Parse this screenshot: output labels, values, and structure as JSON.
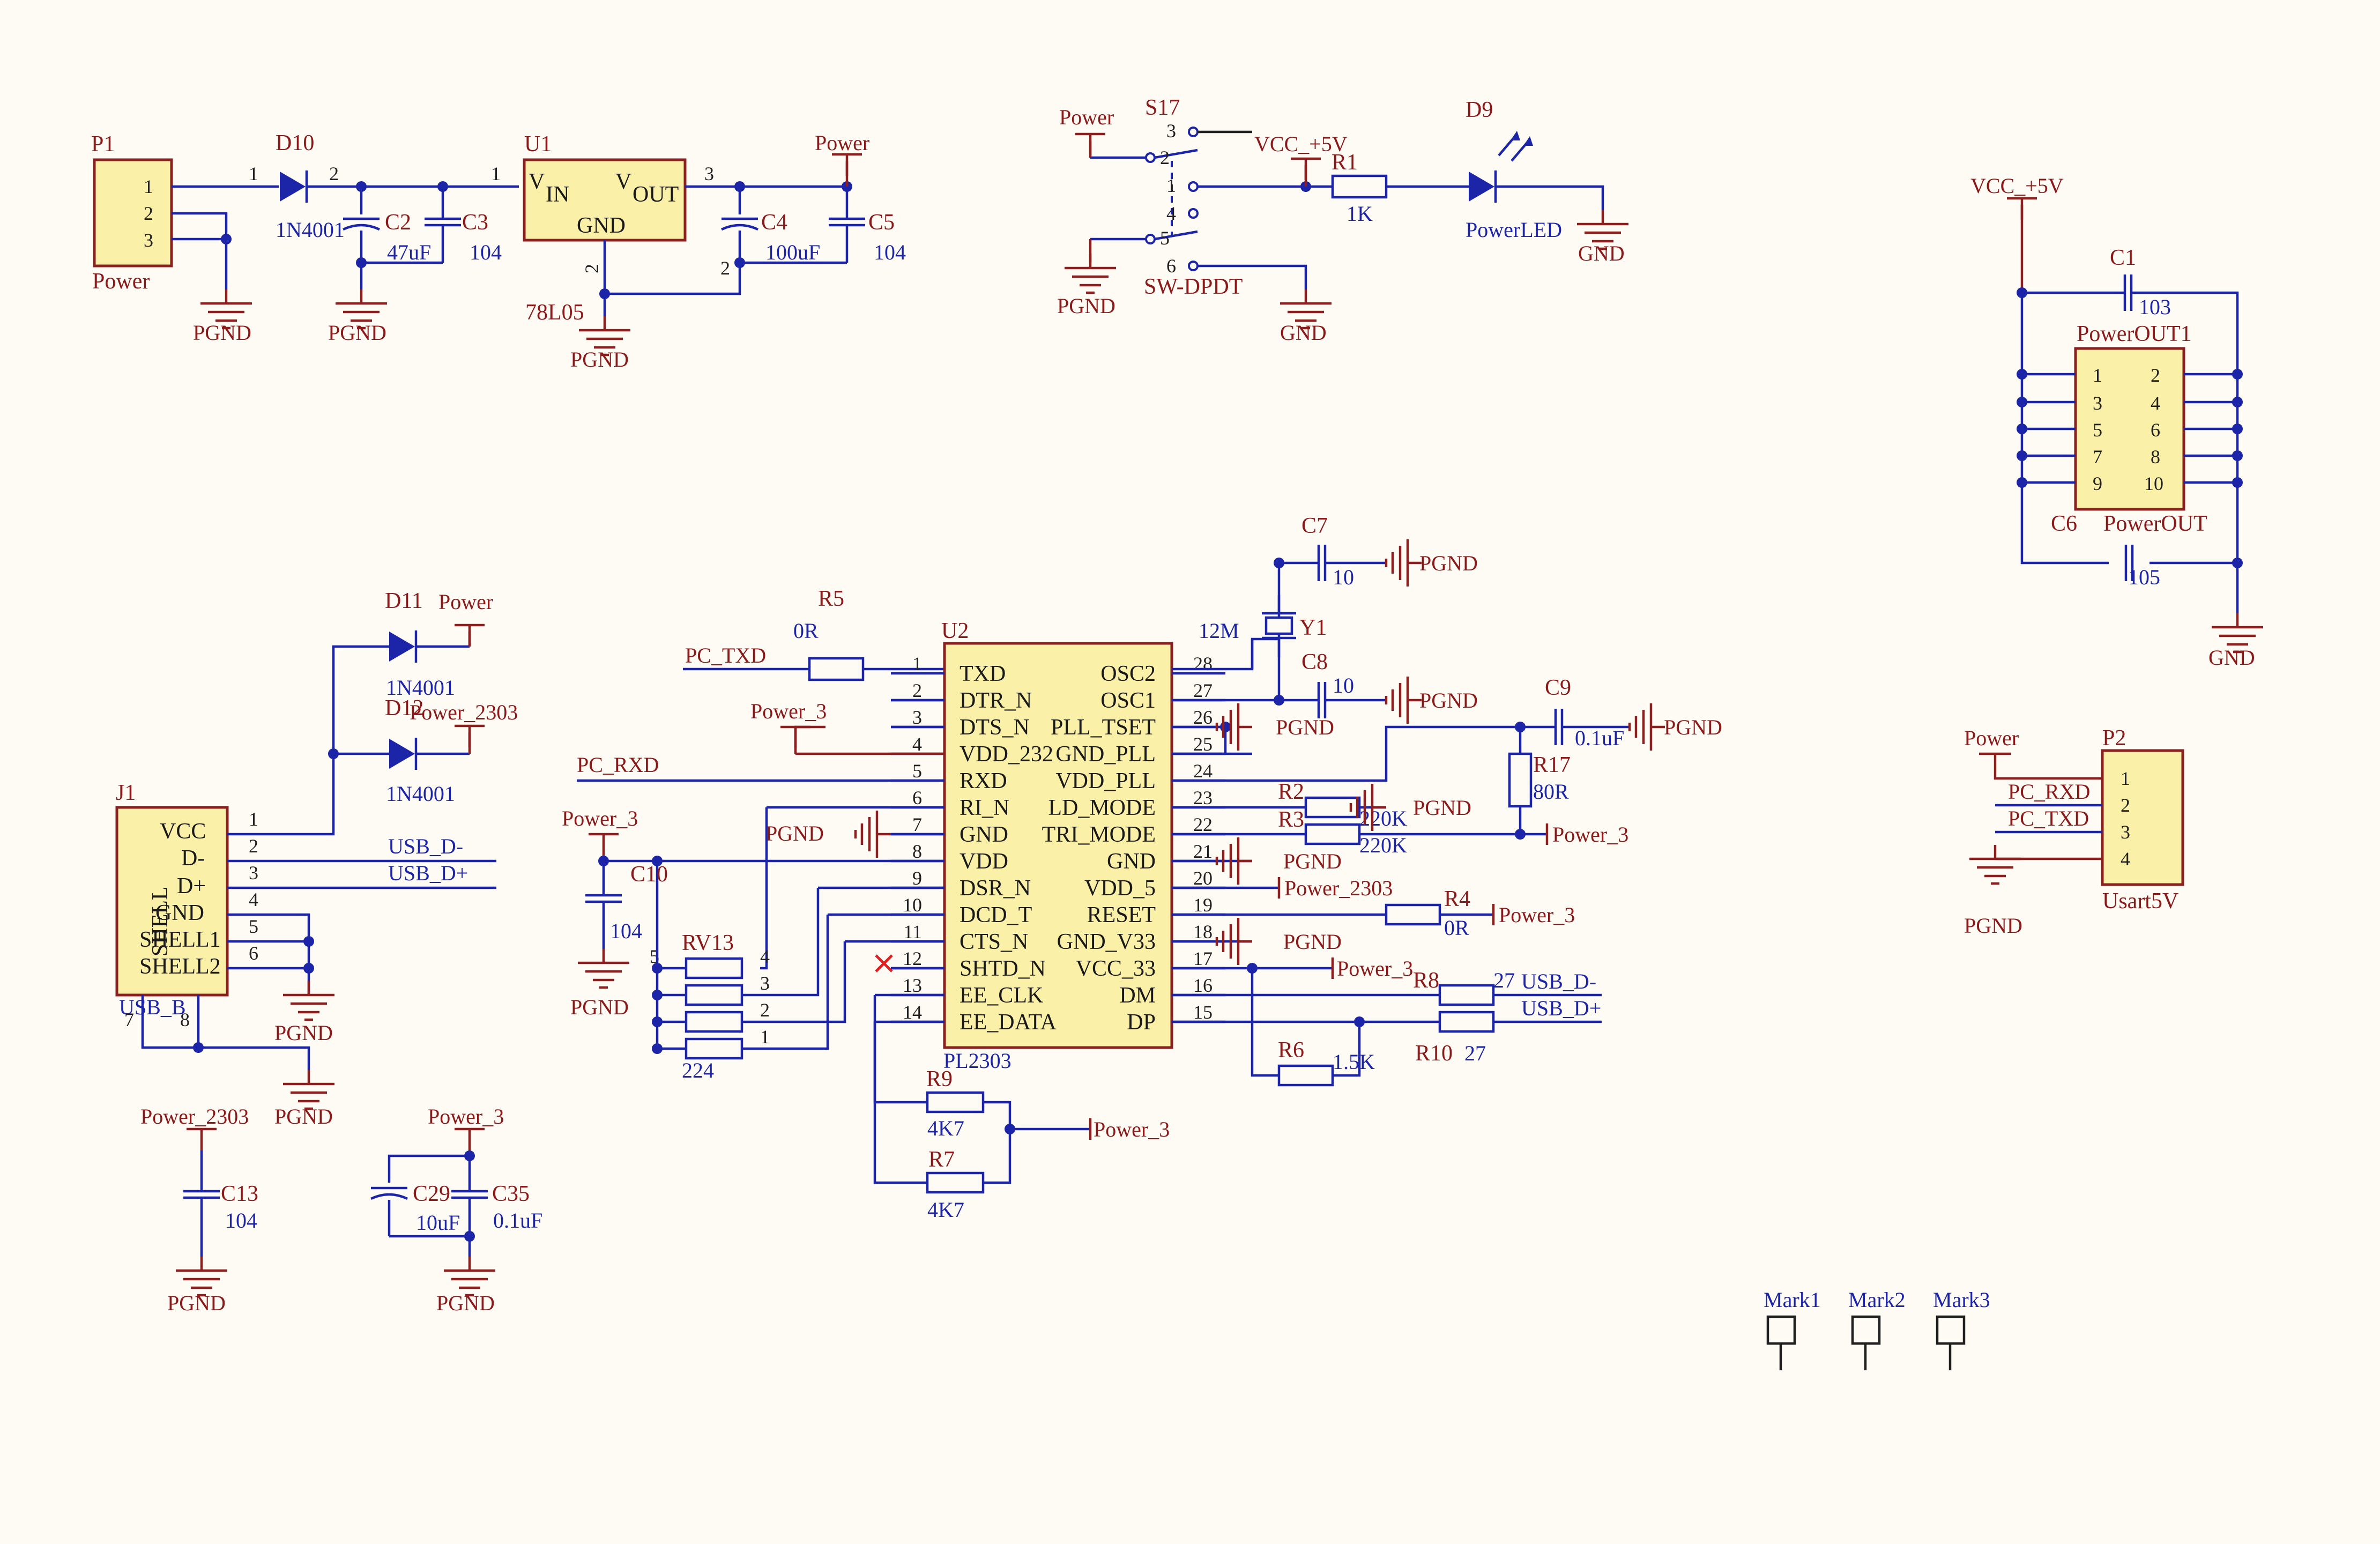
{
  "components": {
    "p1": {
      "ref": "P1",
      "value": "Power",
      "pins": [
        "1",
        "2",
        "3"
      ]
    },
    "d10": {
      "ref": "D10",
      "value": "1N4001",
      "pin_a": "1",
      "pin_k": "2"
    },
    "c2": {
      "ref": "C2",
      "value": "47uF"
    },
    "c3": {
      "ref": "C3",
      "value": "104"
    },
    "u1": {
      "ref": "U1",
      "value": "78L05",
      "vin": "V",
      "vin_sub": "IN",
      "vout": "V",
      "vout_sub": "OUT",
      "gnd": "GND",
      "pin1": "1",
      "pin2": "2",
      "pin3": "3"
    },
    "c4": {
      "ref": "C4",
      "value": "100uF"
    },
    "c5": {
      "ref": "C5",
      "value": "104"
    },
    "s17": {
      "ref": "S17",
      "value": "SW-DPDT",
      "pins": [
        "1",
        "2",
        "3",
        "4",
        "5",
        "6"
      ]
    },
    "r1": {
      "ref": "R1",
      "value": "1K"
    },
    "d9": {
      "ref": "D9",
      "value": "PowerLED"
    },
    "c1": {
      "ref": "C1",
      "value": "103"
    },
    "powerout1": {
      "ref": "PowerOUT1",
      "value": "PowerOUT",
      "left_pins": [
        "1",
        "3",
        "5",
        "7",
        "9"
      ],
      "right_pins": [
        "2",
        "4",
        "6",
        "8",
        "10"
      ]
    },
    "c6": {
      "ref": "C6",
      "value": "105"
    },
    "d11": {
      "ref": "D11",
      "value": "1N4001"
    },
    "d12": {
      "ref": "D12",
      "value": "1N4001"
    },
    "j1": {
      "ref": "J1",
      "value": "USB_B",
      "pins": [
        "1",
        "2",
        "3",
        "4",
        "5",
        "6"
      ],
      "signals": [
        "VCC",
        "D-",
        "D+",
        "GND",
        "SHELL1",
        "SHELL2"
      ],
      "shell": "SHELL",
      "extra_pins": [
        "7",
        "8"
      ]
    },
    "r5": {
      "ref": "R5",
      "value": "0R"
    },
    "u2": {
      "ref": "U2",
      "value": "PL2303",
      "left": [
        {
          "n": "1",
          "s": "TXD"
        },
        {
          "n": "2",
          "s": "DTR_N"
        },
        {
          "n": "3",
          "s": "DTS_N"
        },
        {
          "n": "4",
          "s": "VDD_232"
        },
        {
          "n": "5",
          "s": "RXD"
        },
        {
          "n": "6",
          "s": "RI_N"
        },
        {
          "n": "7",
          "s": "GND"
        },
        {
          "n": "8",
          "s": "VDD"
        },
        {
          "n": "9",
          "s": "DSR_N"
        },
        {
          "n": "10",
          "s": "DCD_T"
        },
        {
          "n": "11",
          "s": "CTS_N"
        },
        {
          "n": "12",
          "s": "SHTD_N"
        },
        {
          "n": "13",
          "s": "EE_CLK"
        },
        {
          "n": "14",
          "s": "EE_DATA"
        }
      ],
      "right": [
        {
          "n": "28",
          "s": "OSC2"
        },
        {
          "n": "27",
          "s": "OSC1"
        },
        {
          "n": "26",
          "s": "PLL_TSET"
        },
        {
          "n": "25",
          "s": "GND_PLL"
        },
        {
          "n": "24",
          "s": "VDD_PLL"
        },
        {
          "n": "23",
          "s": "LD_MODE"
        },
        {
          "n": "22",
          "s": "TRI_MODE"
        },
        {
          "n": "21",
          "s": "GND"
        },
        {
          "n": "20",
          "s": "VDD_5"
        },
        {
          "n": "19",
          "s": "RESET"
        },
        {
          "n": "18",
          "s": "GND_V33"
        },
        {
          "n": "17",
          "s": "VCC_33"
        },
        {
          "n": "16",
          "s": "DM"
        },
        {
          "n": "15",
          "s": "DP"
        }
      ]
    },
    "c10": {
      "ref": "C10",
      "value": "104"
    },
    "rv13": {
      "ref": "RV13",
      "value": "224",
      "pins": [
        "5",
        "4",
        "3",
        "2",
        "1"
      ]
    },
    "c7": {
      "ref": "C7",
      "value": "10"
    },
    "c8": {
      "ref": "C8",
      "value": "10"
    },
    "y1": {
      "ref": "Y1",
      "value": "12M"
    },
    "c9": {
      "ref": "C9",
      "value": "0.1uF"
    },
    "r17": {
      "ref": "R17",
      "value": "80R"
    },
    "r2": {
      "ref": "R2",
      "value": "220K"
    },
    "r3": {
      "ref": "R3",
      "value": "220K"
    },
    "r4": {
      "ref": "R4",
      "value": "0R"
    },
    "r8": {
      "ref": "R8",
      "value": "27"
    },
    "r10": {
      "ref": "R10",
      "value": "27"
    },
    "r6": {
      "ref": "R6",
      "value": "1.5K"
    },
    "r9": {
      "ref": "R9",
      "value": "4K7"
    },
    "r7": {
      "ref": "R7",
      "value": "4K7"
    },
    "p2": {
      "ref": "P2",
      "value": "Usart5V",
      "pins": [
        "1",
        "2",
        "3",
        "4"
      ]
    },
    "c13": {
      "ref": "C13",
      "value": "104"
    },
    "c29": {
      "ref": "C29",
      "value": "10uF"
    },
    "c35": {
      "ref": "C35",
      "value": "0.1uF"
    },
    "marks": [
      "Mark1",
      "Mark2",
      "Mark3"
    ]
  },
  "nets": {
    "power": "Power",
    "pgnd": "PGND",
    "gnd": "GND",
    "vcc5": "VCC_+5V",
    "power_2303": "Power_2303",
    "power_3": "Power_3",
    "pc_txd": "PC_TXD",
    "pc_rxd": "PC_RXD",
    "usb_dm": "USB_D-",
    "usb_dp": "USB_D+"
  },
  "colors": {
    "wire": "#1c24a8",
    "power_net": "#8c2020",
    "body_fill": "#fbf0a8",
    "body_stroke": "#8a2020",
    "background": "#fefbf4",
    "no_connect": "#e02020"
  }
}
